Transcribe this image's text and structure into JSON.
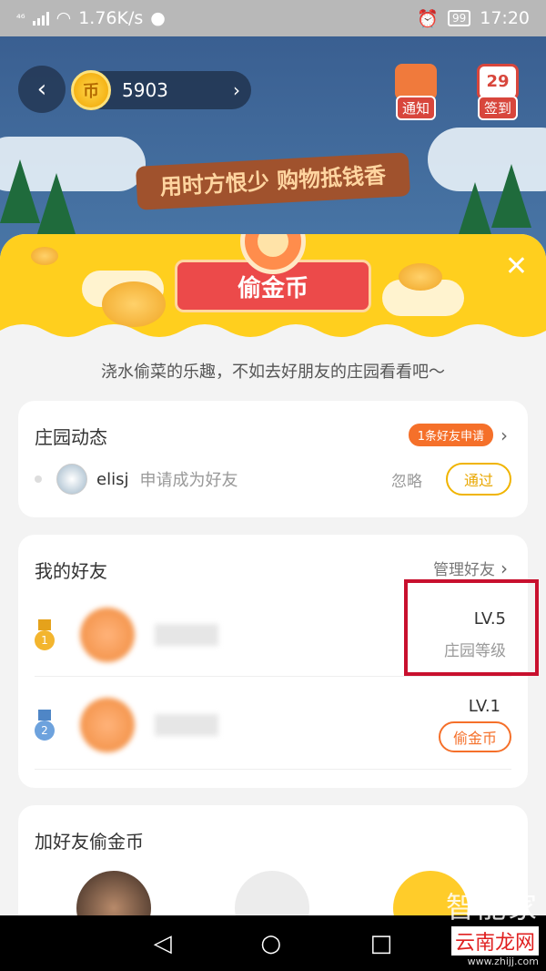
{
  "status_bar": {
    "network": "⁴⁶",
    "speed": "1.76K/s",
    "battery": "99",
    "time": "17:20"
  },
  "top_bar": {
    "coin_count": "5903",
    "coin_glyph": "币",
    "notify_label": "通知",
    "checkin_label": "签到",
    "checkin_day": "29",
    "slogan": "用时方恨少 购物抵钱香"
  },
  "modal": {
    "title": "偷金币",
    "subtitle": "浇水偷菜的乐趣，不如去好朋友的庄园看看吧～",
    "close_icon": "✕"
  },
  "farm_activity": {
    "title": "庄园动态",
    "request_badge": "1条好友申请",
    "request": {
      "username": "elisj",
      "message": "申请成为好友",
      "ignore_label": "忽略",
      "accept_label": "通过"
    }
  },
  "my_friends": {
    "title": "我的好友",
    "manage_label": "管理好友",
    "friends": [
      {
        "rank": "1",
        "level": "LV.5",
        "level_caption": "庄园等级"
      },
      {
        "rank": "2",
        "level": "LV.1",
        "action_label": "偷金币"
      }
    ]
  },
  "add_friends": {
    "title": "加好友偷金币"
  },
  "nav_bar": {
    "back": "◁",
    "home": "○",
    "recent": "□"
  },
  "watermark": {
    "line1": "智能家",
    "line2": "云南龙网",
    "url": "www.zhijj.com"
  },
  "colors": {
    "accent_orange": "#f5702a",
    "accent_yellow": "#ffcf1e",
    "highlight_red": "#c8102e"
  }
}
